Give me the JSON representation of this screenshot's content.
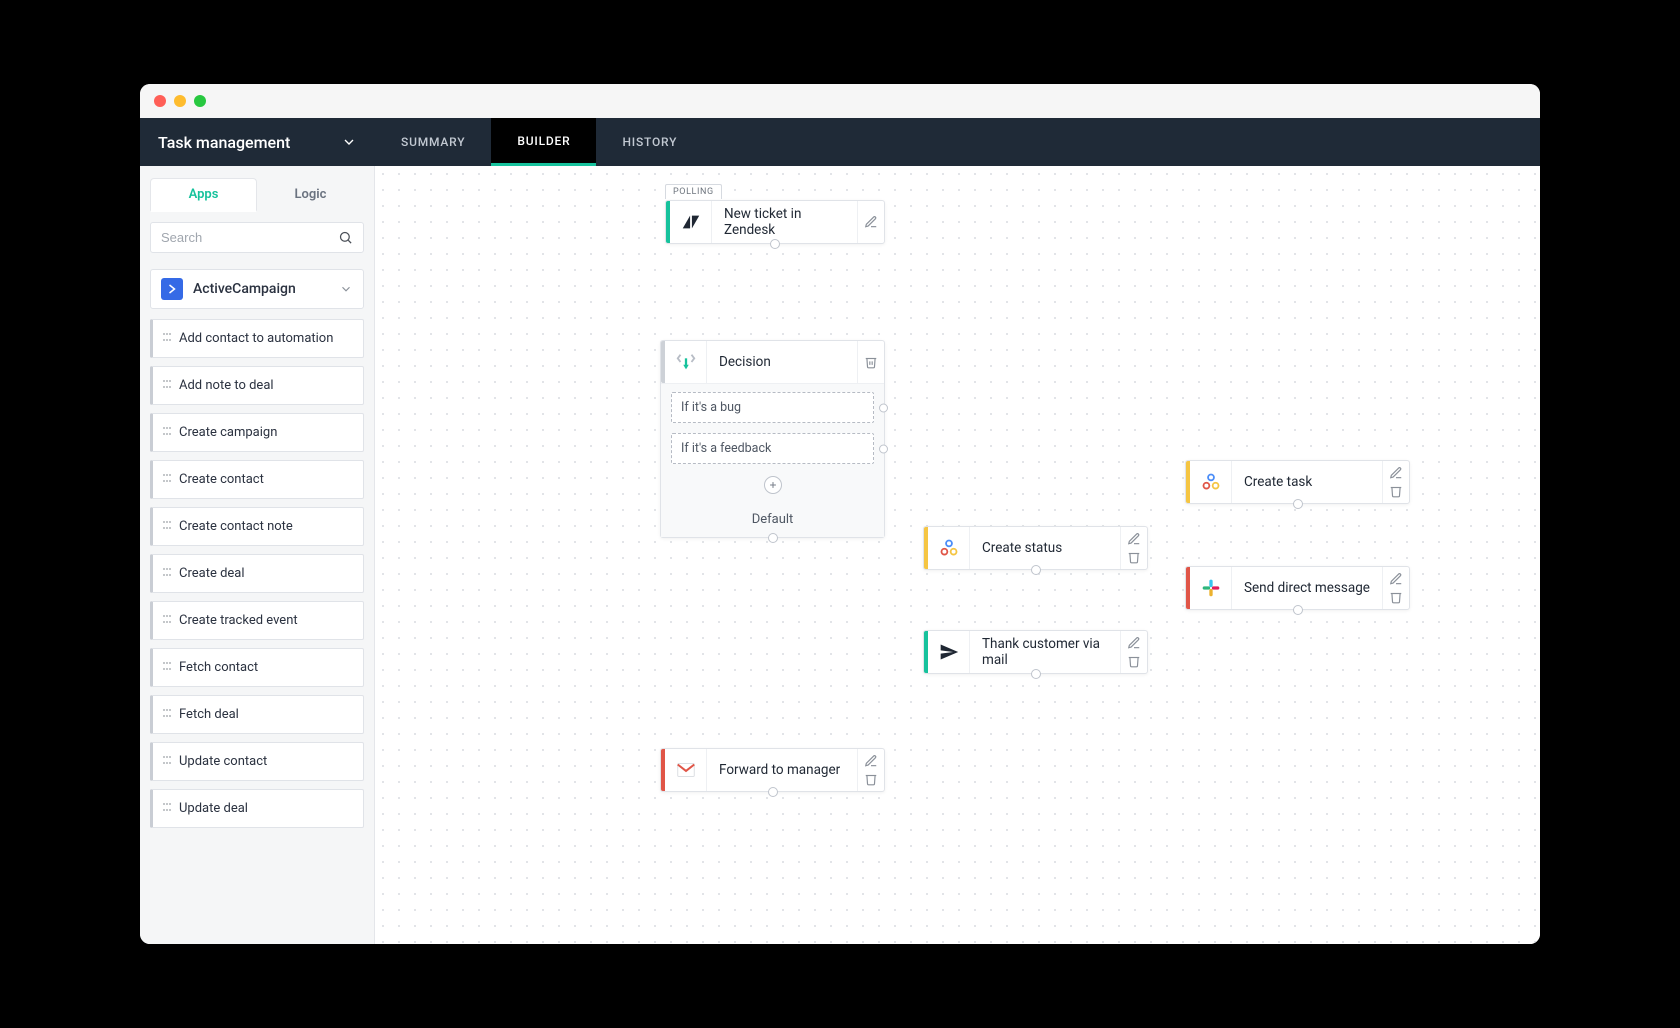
{
  "window_title": "Task management",
  "topbar": {
    "tabs": [
      {
        "label": "SUMMARY",
        "active": false
      },
      {
        "label": "BUILDER",
        "active": true
      },
      {
        "label": "HISTORY",
        "active": false
      }
    ]
  },
  "sidebar": {
    "tabs": [
      {
        "label": "Apps",
        "active": true
      },
      {
        "label": "Logic",
        "active": false
      }
    ],
    "search_placeholder": "Search",
    "app": {
      "name": "ActiveCampaign",
      "actions": [
        "Add contact to automation",
        "Add note to deal",
        "Create campaign",
        "Create contact",
        "Create contact note",
        "Create deal",
        "Create tracked event",
        "Fetch contact",
        "Fetch deal",
        "Update contact",
        "Update deal"
      ]
    }
  },
  "canvas": {
    "polling_badge": "POLLING",
    "nodes": {
      "trigger": {
        "title": "New ticket in Zendesk"
      },
      "decision": {
        "title": "Decision",
        "branches": [
          "If it's a bug",
          "If it's a feedback"
        ],
        "default_label": "Default"
      },
      "create_task": {
        "title": "Create task"
      },
      "send_dm": {
        "title": "Send direct message"
      },
      "create_status": {
        "title": "Create status"
      },
      "thank_customer": {
        "title": "Thank customer via mail"
      },
      "forward": {
        "title": "Forward to manager"
      }
    }
  }
}
